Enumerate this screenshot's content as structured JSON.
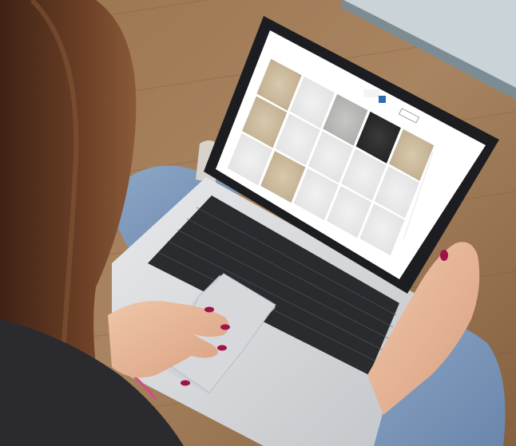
{
  "photo": {
    "subject": "",
    "colors": {
      "floor": "#a07a52",
      "floor_dark": "#7a5636",
      "laptop_body": "#d9dbde",
      "laptop_bezel": "#1c1d20",
      "keyboard": "#2a2b2f",
      "jeans": "#7f9cc0",
      "hair": "#5a3320",
      "skin": "#e9b99a",
      "nail": "#a0124a",
      "shirt": "#2b2a2e",
      "window": "#c9d3d8"
    }
  },
  "screen": {
    "nav_items": [
      "",
      "",
      "",
      "",
      ""
    ],
    "search_placeholder": "",
    "tabs": [
      "",
      "",
      "",
      "",
      ""
    ],
    "sidebar_items": [
      "",
      "",
      "",
      "",
      "",
      "",
      "",
      "",
      ""
    ],
    "tiles": [
      {
        "label": "",
        "texture": "marble-beige"
      },
      {
        "label": "",
        "texture": "marble-beige"
      },
      {
        "label": "",
        "texture": "marble-white"
      },
      {
        "label": "",
        "texture": "marble-white"
      },
      {
        "label": "",
        "texture": "marble-white"
      },
      {
        "label": "",
        "texture": "marble-beige"
      },
      {
        "label": "",
        "texture": "granite-grey"
      },
      {
        "label": "",
        "texture": "marble-white"
      },
      {
        "label": "",
        "texture": "marble-white"
      },
      {
        "label": "",
        "texture": "marble-dark"
      },
      {
        "label": "",
        "texture": "marble-white"
      },
      {
        "label": "",
        "texture": "marble-white"
      },
      {
        "label": "",
        "texture": "marble-beige"
      },
      {
        "label": "",
        "texture": "marble-white"
      },
      {
        "label": "",
        "texture": "marble-white"
      }
    ]
  }
}
